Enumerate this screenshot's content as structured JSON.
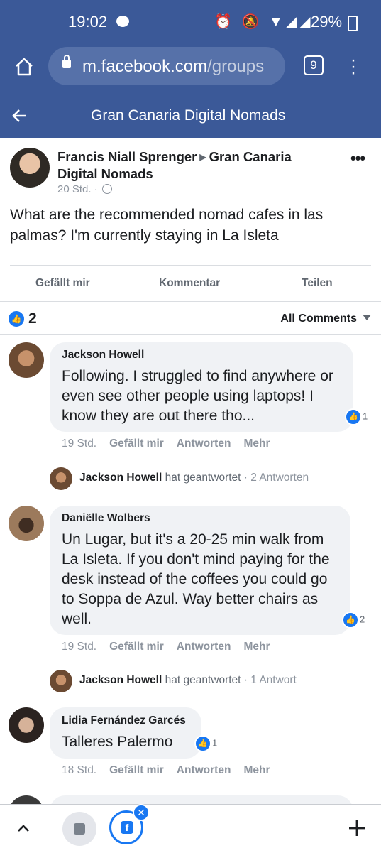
{
  "status_bar": {
    "time": "19:02",
    "icons": "⏰ 🔕 ▼◢◢",
    "battery": "29%"
  },
  "browser": {
    "url_host": "m.facebook.com",
    "url_path": "/groups",
    "tab_count": "9"
  },
  "header": {
    "title": "Gran Canaria Digital Nomads"
  },
  "post": {
    "author": "Francis Niall Sprenger",
    "group": "Gran Canaria Digital Nomads",
    "time": "20 Std. ·",
    "text": "What are the recommended nomad cafes in las palmas? I'm currently staying in La Isleta",
    "actions": {
      "like": "Gefällt mir",
      "comment": "Kommentar",
      "share": "Teilen"
    },
    "like_count": "2",
    "sort_label": "All Comments"
  },
  "comments": [
    {
      "name": "Jackson Howell",
      "text": "Following. I struggled to find anywhere or even see other people using laptops! I know they are out there tho...",
      "reactions": "1",
      "time": "19 Std.",
      "like": "Gefällt mir",
      "reply": "Antworten",
      "more": "Mehr",
      "reply_summary": {
        "name": "Jackson Howell",
        "action": "hat geantwortet",
        "count": "· 2 Antworten"
      }
    },
    {
      "name": "Daniëlle Wolbers",
      "text": "Un Lugar, but it's a 20-25 min walk from La Isleta. If you don't mind paying for the desk instead of the coffees you could go to Soppa de Azul. Way better chairs as well.",
      "reactions": "2",
      "time": "19 Std.",
      "like": "Gefällt mir",
      "reply": "Antworten",
      "more": "Mehr",
      "reply_summary": {
        "name": "Jackson Howell",
        "action": "hat geantwortet",
        "count": "· 1 Antwort"
      }
    },
    {
      "name": "Lidia Fernández Garcés",
      "text": "Talleres Palermo",
      "reactions": "1",
      "time": "18 Std.",
      "like": "Gefällt mir",
      "reply": "Antworten",
      "more": "Mehr"
    }
  ],
  "colors": {
    "brand": "#3b5998",
    "like_blue": "#1877f2",
    "bubble": "#f0f2f5"
  },
  "icons": {
    "home": "home-icon",
    "lock": "lock-icon",
    "back": "arrow-left-icon",
    "like": "thumbs-up-icon",
    "up": "chevron-up-icon",
    "plus": "plus-icon"
  }
}
